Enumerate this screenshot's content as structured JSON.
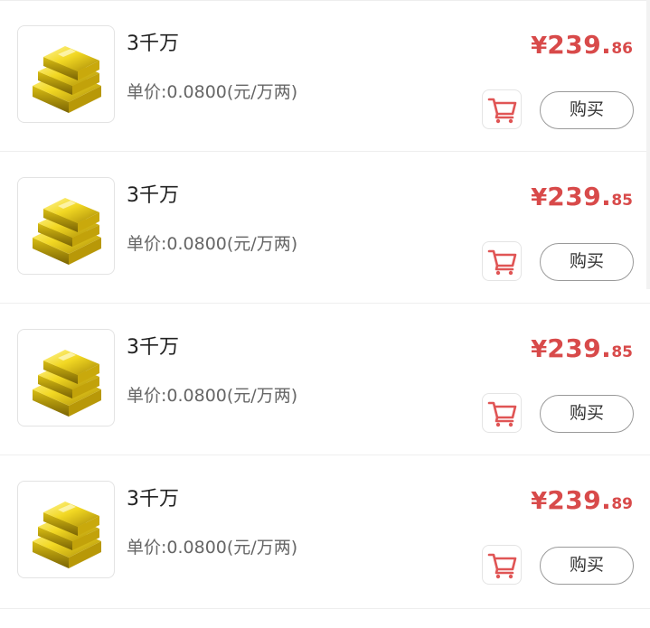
{
  "items": [
    {
      "title": "3千万",
      "unit_price": "单价:0.0800(元/万两)",
      "price_symbol": "¥",
      "price_int": "239.",
      "price_dec": "86",
      "buy_label": "购买",
      "image_icon": "gold-bars-icon",
      "cart_icon": "cart-icon"
    },
    {
      "title": "3千万",
      "unit_price": "单价:0.0800(元/万两)",
      "price_symbol": "¥",
      "price_int": "239.",
      "price_dec": "85",
      "buy_label": "购买",
      "image_icon": "gold-bars-icon",
      "cart_icon": "cart-icon"
    },
    {
      "title": "3千万",
      "unit_price": "单价:0.0800(元/万两)",
      "price_symbol": "¥",
      "price_int": "239.",
      "price_dec": "85",
      "buy_label": "购买",
      "image_icon": "gold-bars-icon",
      "cart_icon": "cart-icon"
    },
    {
      "title": "3千万",
      "unit_price": "单价:0.0800(元/万两)",
      "price_symbol": "¥",
      "price_int": "239.",
      "price_dec": "89",
      "buy_label": "购买",
      "image_icon": "gold-bars-icon",
      "cart_icon": "cart-icon"
    }
  ],
  "colors": {
    "price": "#d84a4a",
    "cart_icon": "#e05555",
    "gold": "#f0d020",
    "border": "#e3e3e3"
  }
}
